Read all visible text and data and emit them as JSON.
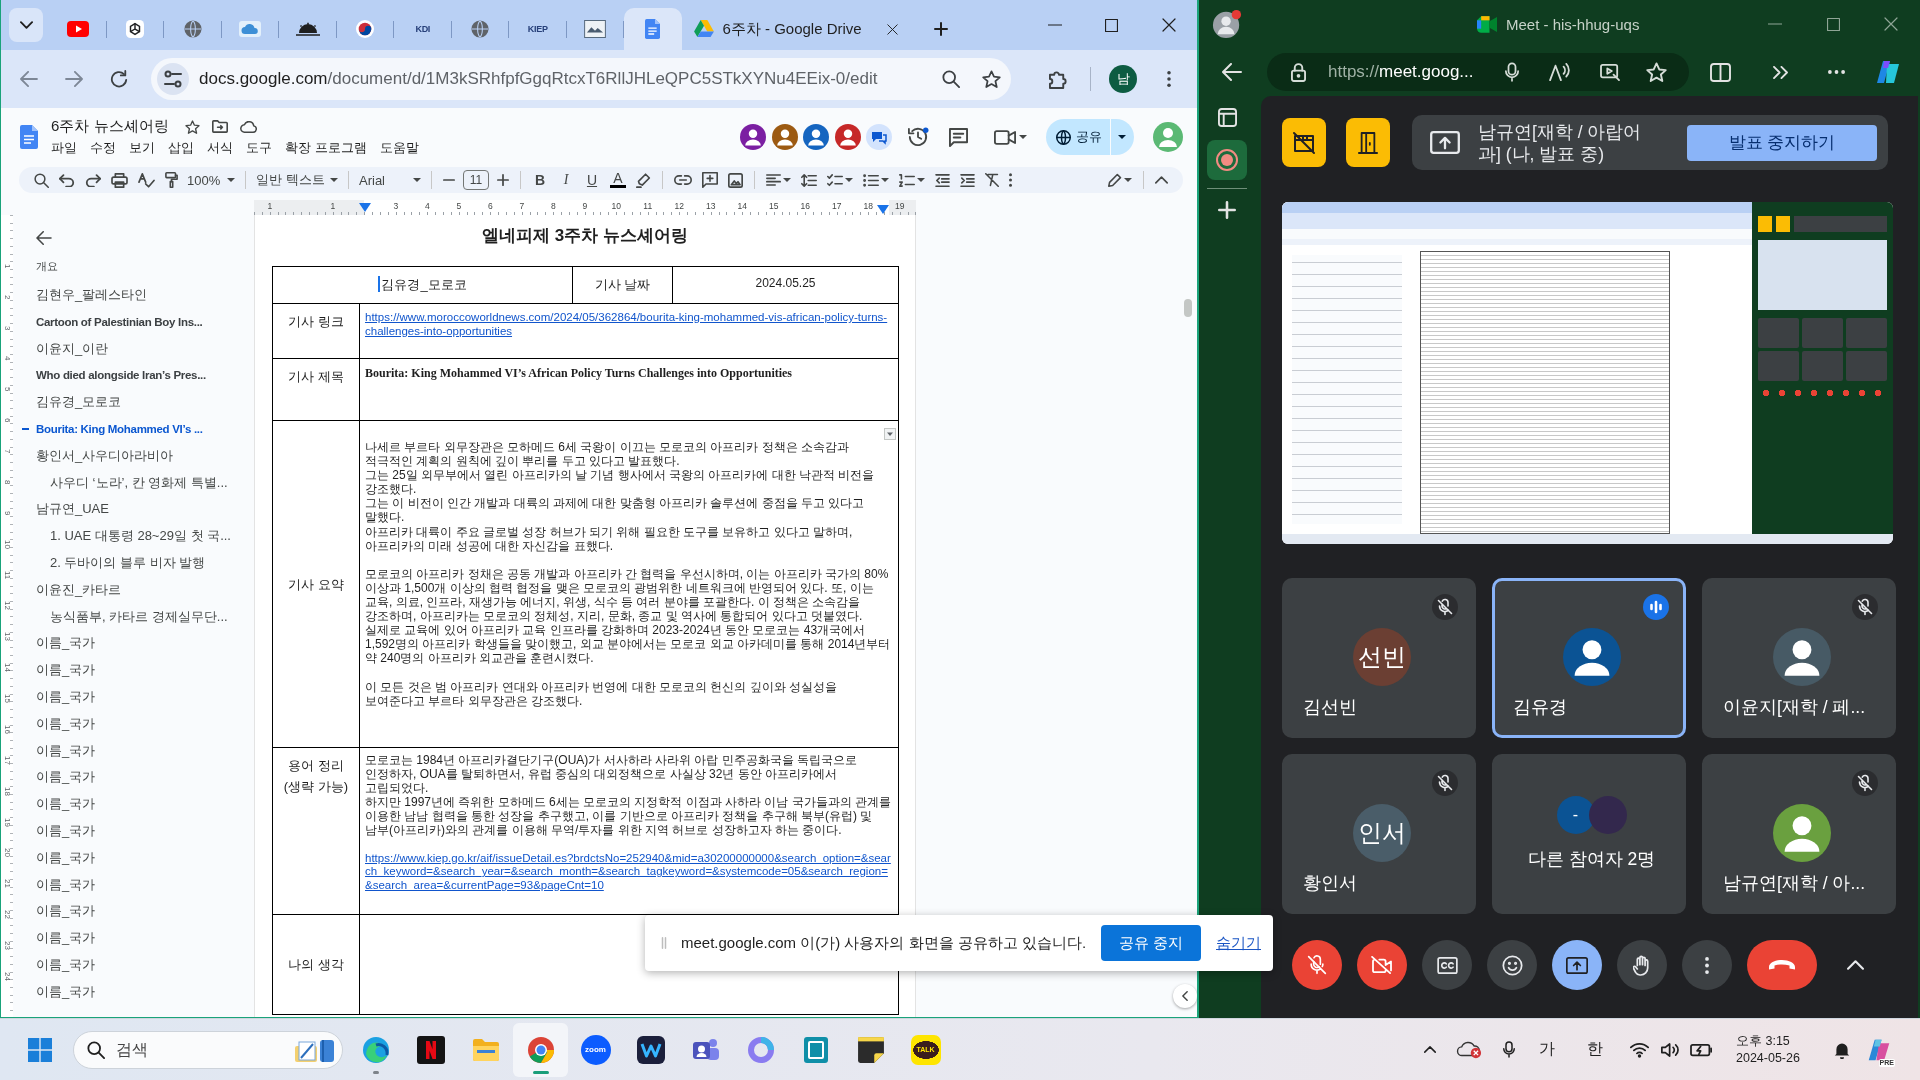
{
  "chrome": {
    "tabs": [
      {
        "selected": false
      },
      {
        "selected": false
      },
      {
        "selected": false
      },
      {
        "selected": false
      },
      {
        "selected": false
      },
      {
        "selected": false
      },
      {
        "logo": "KDI",
        "selected": false
      },
      {
        "selected": false
      },
      {
        "logo": "KIEP",
        "selected": false
      },
      {
        "selected": false
      },
      {
        "selected": true
      },
      {
        "title": "6주차 - Google Drive",
        "selected": false
      }
    ],
    "url_host": "docs.google.com",
    "url_path": "/document/d/1M3kSRhfpfGgqRtcxT6RllJHLeQPC5STkXYNu4EEix-0/edit",
    "profile_initial": "남"
  },
  "docs": {
    "title": "6주차 뉴스셰어링",
    "menu": [
      "파일",
      "수정",
      "보기",
      "삽입",
      "서식",
      "도구",
      "확장 프로그램",
      "도움말"
    ],
    "collaborators": [
      {
        "color": "#7b1fa2"
      },
      {
        "color": "#9c5a12"
      },
      {
        "color": "#1565c0"
      },
      {
        "color": "#c62828"
      }
    ],
    "share_label": "공유",
    "toolbar": {
      "zoom": "100%",
      "style": "일반 텍스트",
      "font": "Arial",
      "font_size": "11",
      "text_format": [
        "B",
        "I",
        "U",
        "A"
      ]
    },
    "ruler_labels": [
      "1",
      "1",
      "3",
      "4",
      "5",
      "6",
      "7",
      "8",
      "9",
      "10",
      "11",
      "12",
      "13",
      "14",
      "15",
      "16",
      "17",
      "18",
      "19"
    ],
    "vertical_ruler_labels": [
      "1",
      "2",
      "3",
      "4",
      "5",
      "6",
      "7",
      "8",
      "9",
      "10",
      "11",
      "12",
      "13",
      "14",
      "15",
      "16",
      "17",
      "18",
      "19",
      "20",
      "21",
      "22",
      "23",
      "24"
    ],
    "outline": {
      "heading": "개요",
      "items": [
        {
          "label": "김현우_팔레스타인",
          "kind": "heading",
          "selected": false
        },
        {
          "label": "Cartoon of Palestinian Boy Ins...",
          "kind": "title",
          "selected": false
        },
        {
          "label": "이윤지_이란",
          "kind": "heading",
          "selected": false
        },
        {
          "label": "Who died alongside Iran’s Pres...",
          "kind": "title",
          "selected": false
        },
        {
          "label": "김유경_모로코",
          "kind": "heading",
          "selected": false
        },
        {
          "label": "Bourita: King Mohammed VI’s ...",
          "kind": "title",
          "selected": true
        },
        {
          "label": "황인서_사우디아라비아",
          "kind": "heading",
          "selected": false,
          "children": [
            {
              "label": "사우디 ‘노라’, 칸 영화제 특별...",
              "kind": "heading",
              "selected": false
            }
          ]
        },
        {
          "label": "남규연_UAE",
          "kind": "heading",
          "selected": false,
          "children": [
            {
              "label": "1. UAE 대통령 28~29일 첫 국...",
              "kind": "heading",
              "selected": false
            },
            {
              "label": "2. 두바이의 블루 비자 발행",
              "kind": "heading",
              "selected": false
            }
          ]
        },
        {
          "label": "이윤진_카타르",
          "kind": "heading",
          "selected": false,
          "children": [
            {
              "label": "농식품부, 카타르 경제실무단...",
              "kind": "heading",
              "selected": false
            }
          ]
        },
        {
          "label": "이름_국가",
          "kind": "heading",
          "selected": false
        },
        {
          "label": "이름_국가",
          "kind": "heading",
          "selected": false
        },
        {
          "label": "이름_국가",
          "kind": "heading",
          "selected": false
        },
        {
          "label": "이름_국가",
          "kind": "heading",
          "selected": false
        },
        {
          "label": "이름_국가",
          "kind": "heading",
          "selected": false
        },
        {
          "label": "이름_국가",
          "kind": "heading",
          "selected": false
        },
        {
          "label": "이름_국가",
          "kind": "heading",
          "selected": false
        },
        {
          "label": "이름_국가",
          "kind": "heading",
          "selected": false
        },
        {
          "label": "이름_국가",
          "kind": "heading",
          "selected": false
        },
        {
          "label": "이름_국가",
          "kind": "heading",
          "selected": false
        },
        {
          "label": "이름_국가",
          "kind": "heading",
          "selected": false
        },
        {
          "label": "이름_국가",
          "kind": "heading",
          "selected": false
        },
        {
          "label": "이름_국가",
          "kind": "heading",
          "selected": false
        },
        {
          "label": "이름_국가",
          "kind": "heading",
          "selected": false
        }
      ]
    },
    "heading": "엘네피제 3주차 뉴스셰어링",
    "table": {
      "header": {
        "name": "김유경_모로코",
        "date_label": "기사 날짜",
        "date": "2024.05.25"
      },
      "rows": [
        {
          "kind": "link",
          "label": "기사 링크",
          "link": "https://www.moroccoworldnews.com/2024/05/362864/bourita-king-mohammed-vis-african-policy-turns-challenges-into-opportunities"
        },
        {
          "kind": "title",
          "label": "기사 제목",
          "text": "Bourita: King Mohammed VI’s African Policy Turns Challenges into Opportunities"
        },
        {
          "kind": "summary",
          "label": "기사 요약",
          "blocks": [
            [
              "나세르 부르타 외무장관은 모하메드 6세 국왕이 이끄는 모로코의 아프리카 정책은 소속감과 적극적인 계획의 원칙에 깊이 뿌리를 두고 있다고 발표했다.",
              "그는 25일 외무부에서 열린 아프리카의 날 기념 행사에서 국왕의 아프리카에 대한 낙관적 비전을 강조했다.",
              "그는 이 비전이 인간 개발과 대륙의 과제에 대한 맞춤형 아프리카 솔루션에 중점을 두고 있다고 말했다.",
              "아프리카 대륙이 주요 글로벌 성장 허브가 되기 위해 필요한 도구를 보유하고 있다고 말하며, 아프리카의 미래 성공에 대한 자신감을 표했다."
            ],
            [
              "모로코의 아프리카 정채은 공동 개발과 아프리카 간 협력을 우선시하며, 이는 아프리카 국가의 80% 이상과 1,500개 이상의 협력 협정을 맺은 모로코의 광범위한 네트워크에 반영되어 있다. 또, 이는 교육, 의료, 인프라, 재생가능 에너지, 위생, 식수 등 여러 분야를 포괄한다. 이 정책은 소속감을 강조하며, 아프리카는 모로코의 정체성, 지리, 문화, 종교 및 역사에 통합되어 있다고 덧붙였다.",
              "실제로 교육에 있어 아프리카 교육 인프라를 강화하며 2023-2024년 동안 모로코는 43개국에서 1,592명의 아프리카 학생들을 맞이했고, 외교 분야에서는 모로코 외교 아카데미를 통해 2014년부터 약 240명의 아프리카 외교관을 훈련시켰다."
            ],
            [
              "이 모든 것은 범 아프리카 연대와 아프리카 번영에 대한 모로코의 헌신의 깊이와 성실성을 보여준다고 부르타 외무장관은 강조했다."
            ]
          ]
        },
        {
          "kind": "terms",
          "label": "용어 정리 (생략 가능)",
          "paragraphs": [
            "모로코는 1984년 아프리카결단기구(OUA)가 서사하라 사라위 아랍 민주공화국을 독립국으로 인정하자, OUA를 탈퇴하면서, 유럽 중심의 대외정책으로 사실상 32년 동안 아프리카에서 고립되었다.",
            "하지만 1997년에 즉위한 모하메드 6세는 모로코의 지정학적 이점과 사하라 이남 국가들과의 관계를 이용한 남남 협력을 통한 성장을 추구했고, 이를 기반으로 아프리카 정책을 추구해 북부(유럽) 및 남부(아프리카)와의 관계를 이용해 무역/투자를 위한 지역 허브로 성장하고자 하는 중이다."
          ],
          "link": "https://www.kiep.go.kr/aif/issueDetail.es?brdctsNo=252940&mid=a30200000000&search_option=&search_keyword=&search_year=&search_month=&search_tagkeyword=&systemcode=05&search_region=&search_area=&currentPage=93&pageCnt=10"
        },
        {
          "kind": "blank",
          "label": "나의 생각"
        }
      ]
    }
  },
  "share_notice": {
    "message": "meet.google.com 이(가) 사용자의 화면을 공유하고 있습니다.",
    "stop_button": "공유 중지",
    "hide_link": "숨기기"
  },
  "edge": {
    "title": "Meet - his-hhug-uqs",
    "url_scheme": "https://",
    "url_host": "meet.goog..."
  },
  "meet": {
    "presenter": "남규연[재학 / 아랍어과] (나, 발표 중)",
    "stop_button": "발표 중지하기",
    "tiles": [
      {
        "kind": "initials",
        "name": "김선빈",
        "initials": "선빈",
        "color": "#6b3f33",
        "muted": true,
        "speaking": false
      },
      {
        "kind": "silhouette",
        "name": "김유경",
        "color": "#0b5394",
        "muted": false,
        "speaking": true
      },
      {
        "kind": "silhouette",
        "name": "이윤지[재학 / 페...",
        "color": "#475a65",
        "muted": true,
        "speaking": false
      },
      {
        "kind": "initials",
        "name": "황인서",
        "initials": "인서",
        "color": "#4a5d69",
        "muted": true,
        "speaking": false
      },
      {
        "kind": "group",
        "name": "다른 참여자 2명",
        "others": [
          {
            "kind": "initials",
            "initials": "-",
            "color": "#0b5394"
          },
          {
            "kind": "photo"
          }
        ],
        "muted": false,
        "speaking": false
      },
      {
        "kind": "silhouette",
        "name": "남규연[재학 / 아...",
        "color": "#6aa03f",
        "muted": true,
        "speaking": false
      }
    ],
    "controls": {
      "mic_on": false,
      "camera_on": false,
      "captions_on": false,
      "presenting": true,
      "hand_raised": false
    }
  },
  "taskbar": {
    "search_placeholder": "검색",
    "apps": [
      {
        "running": true,
        "selected": false
      },
      {
        "running": false,
        "selected": false
      },
      {
        "running": false,
        "selected": false
      },
      {
        "running": true,
        "selected": true
      },
      {
        "logo": "zoom",
        "running": false,
        "selected": false
      },
      {
        "running": false,
        "selected": false
      },
      {
        "running": false,
        "selected": false
      },
      {
        "running": false,
        "selected": false
      },
      {
        "running": false,
        "selected": false
      },
      {
        "running": false,
        "selected": false
      },
      {
        "logo": "TALK",
        "running": false,
        "selected": false
      }
    ],
    "ime_mode": "가",
    "ime_lang": "한",
    "time": "오후 3:15",
    "date": "2024-05-26",
    "copilot_badge": "PRE"
  }
}
